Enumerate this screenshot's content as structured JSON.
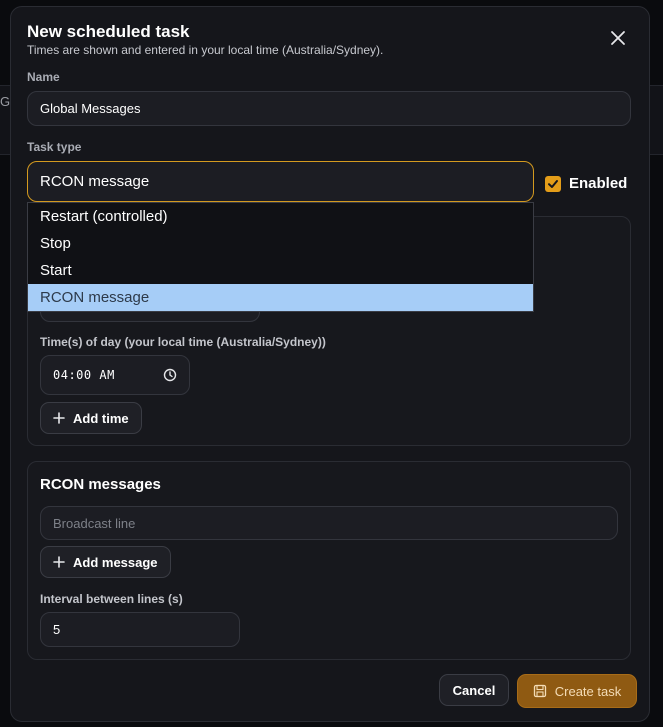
{
  "backdrop": {
    "fragment": "G"
  },
  "modal": {
    "title": "New scheduled task",
    "subtitle": "Times are shown and entered in your local time (Australia/Sydney)."
  },
  "name_field": {
    "label": "Name",
    "value": "Global Messages"
  },
  "task_type": {
    "label": "Task type",
    "selected": "RCON message",
    "options": [
      "Restart (controlled)",
      "Stop",
      "Start",
      "RCON message"
    ]
  },
  "enabled": {
    "label": "Enabled",
    "checked": true
  },
  "schedule": {
    "times_label": "Time(s) of day (your local time (Australia/Sydney))",
    "time_value": "04:00 AM",
    "add_time_label": "Add time"
  },
  "rcon": {
    "title": "RCON messages",
    "line_placeholder": "Broadcast line",
    "add_message_label": "Add message",
    "interval_label": "Interval between lines (s)",
    "interval_value": "5"
  },
  "footer": {
    "cancel_label": "Cancel",
    "create_label": "Create task"
  },
  "colors": {
    "accent": "#e39d19",
    "selected_option": "#a6cdf7"
  }
}
